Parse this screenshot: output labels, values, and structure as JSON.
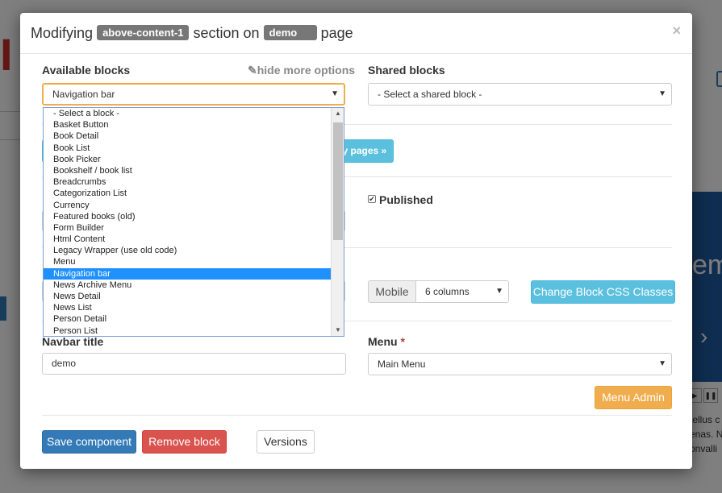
{
  "modal": {
    "title_prefix": "Modifying",
    "section_name": "above-content-1",
    "title_middle": "section on",
    "page_name": "demo",
    "title_suffix": "page",
    "close_glyph": "×"
  },
  "available_blocks": {
    "label": "Available blocks",
    "hide_more_options": "hide more options",
    "selected_value": "Navigation bar",
    "options": [
      "- Select a block -",
      "Basket Button",
      "Book Detail",
      "Book List",
      "Book Picker",
      "Bookshelf / book list",
      "Breadcrumbs",
      "Categorization List",
      "Currency",
      "Featured books (old)",
      "Form Builder",
      "Html Content",
      "Legacy Wrapper (use old code)",
      "Menu",
      "Navigation bar",
      "News Archive Menu",
      "News Detail",
      "News List",
      "Person Detail",
      "Person List"
    ],
    "selected_index": 14
  },
  "shared_blocks": {
    "label": "Shared blocks",
    "placeholder": "- Select a shared block -"
  },
  "partial_button": "my pages »",
  "published": {
    "label": "Published",
    "checked": true
  },
  "responsive": {
    "device_label": "Mobile",
    "columns_value": "6 columns",
    "css_button": "Change Block CSS Classes"
  },
  "navbar_title": {
    "label": "Navbar title",
    "value": "demo"
  },
  "menu": {
    "label": "Menu",
    "required_mark": "*",
    "value": "Main Menu",
    "admin_button": "Menu Admin"
  },
  "footer": {
    "save": "Save component",
    "remove": "Remove block",
    "versions": "Versions"
  },
  "background": {
    "hero_text": "em",
    "hero_arrow": "›",
    "body_text": [
      "tellus c",
      "enas. N",
      "onvalli"
    ]
  },
  "colors": {
    "primary": "#337ab7",
    "danger": "#d9534f",
    "info": "#5bc0de",
    "warning": "#f0ad4e",
    "label_gray": "#777777"
  }
}
